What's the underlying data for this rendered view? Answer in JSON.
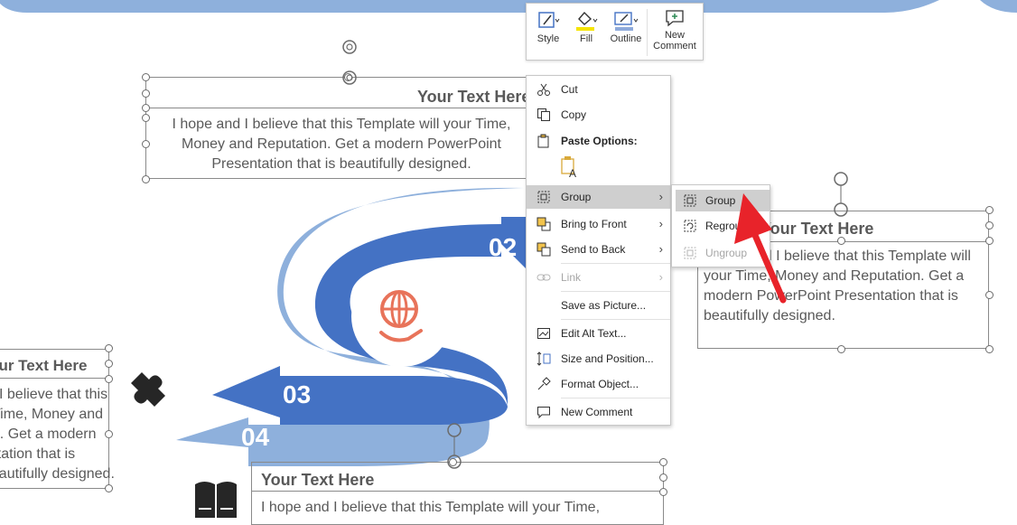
{
  "colors": {
    "accent_dark": "#4472c4",
    "accent_light": "#8eb0dc",
    "icon_orange": "#e8735a",
    "arrow_red": "#e8232a",
    "highlight": "#cfcfcf",
    "text_gray": "#595959"
  },
  "slide": {
    "top_box": {
      "title": "Your Text  Here",
      "body": "I hope and I believe that this Template will your Time, Money and Reputation. Get a modern PowerPoint  Presentation that is beautifully designed."
    },
    "right_box": {
      "title": "Your Text  Here",
      "body": "I hope and I believe that this Template will your Time, Money and Reputation. Get a modern PowerPoint  Presentation that is beautifully designed."
    },
    "left_box": {
      "title": "Your Text  Here",
      "lines": [
        "I believe that this",
        "Time, Money and",
        "tion. Get a modern",
        "sentation that is",
        "beautifully designed."
      ]
    },
    "bottom_box": {
      "title": "Your Text  Here",
      "body": "I hope and I believe that this Template will your Time,"
    },
    "numbers": {
      "n02": "02",
      "n03": "03",
      "n04": "04"
    },
    "icons": [
      "globe-hand-icon",
      "puzzle-icon",
      "book-icon"
    ]
  },
  "mini_toolbar": {
    "style": "Style",
    "fill": "Fill",
    "outline": "Outline",
    "new_comment_1": "New",
    "new_comment_2": "Comment"
  },
  "context_menu": {
    "cut": "Cut",
    "copy": "Copy",
    "paste_options": "Paste Options:",
    "group": "Group",
    "bring_to_front": "Bring to Front",
    "send_to_back": "Send to Back",
    "link": "Link",
    "save_as_picture": "Save as Picture...",
    "edit_alt_text": "Edit Alt Text...",
    "size_and_position": "Size and Position...",
    "format_object": "Format Object...",
    "new_comment": "New Comment"
  },
  "group_submenu": {
    "group": "Group",
    "regroup": "Regroup",
    "ungroup": "Ungroup"
  }
}
